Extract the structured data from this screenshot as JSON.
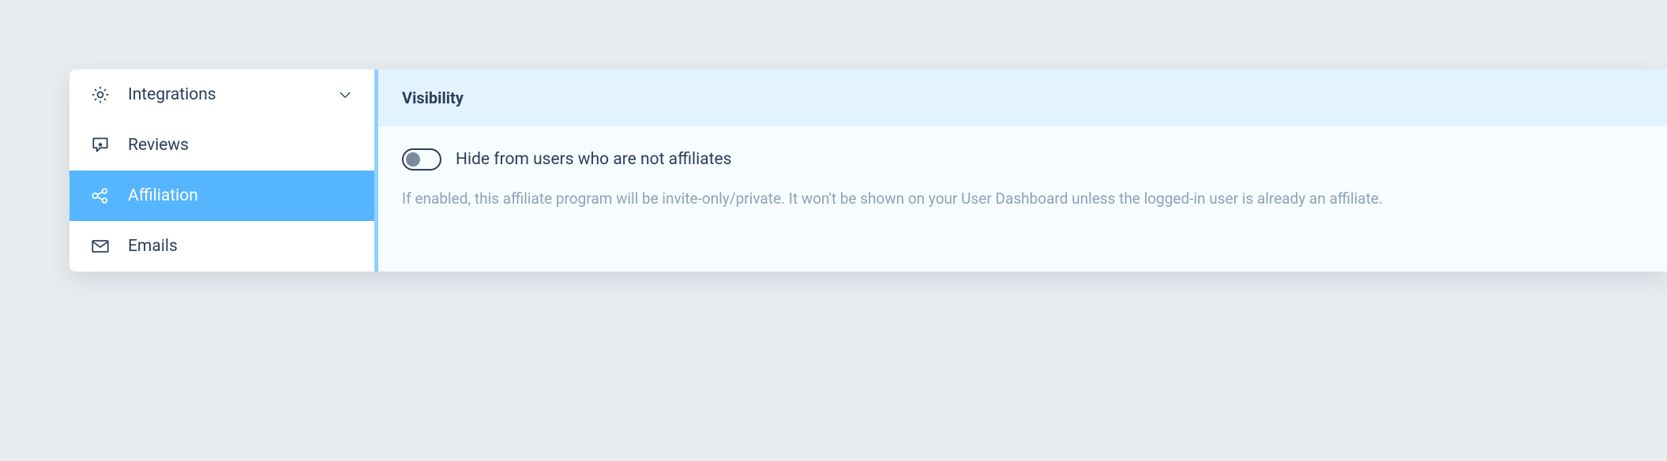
{
  "sidebar": {
    "items": [
      {
        "label": "Integrations",
        "icon": "gear",
        "active": false,
        "expandable": true
      },
      {
        "label": "Reviews",
        "icon": "review",
        "active": false,
        "expandable": false
      },
      {
        "label": "Affiliation",
        "icon": "affiliation",
        "active": true,
        "expandable": false
      },
      {
        "label": "Emails",
        "icon": "mail",
        "active": false,
        "expandable": false
      }
    ]
  },
  "main": {
    "section_title": "Visibility",
    "toggle": {
      "label": "Hide from users who are not affiliates",
      "checked": false
    },
    "help": "If enabled, this affiliate program will be invite-only/private. It won't be shown on your User Dashboard unless the logged-in user is already an affiliate."
  }
}
